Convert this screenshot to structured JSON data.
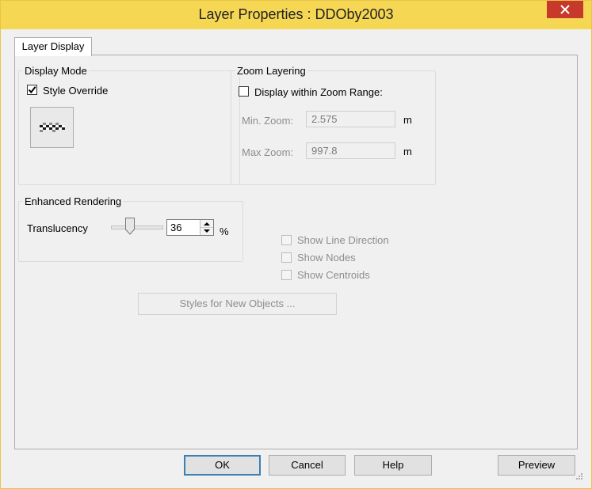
{
  "window": {
    "title": "Layer Properties  : DDOby2003"
  },
  "tabs": [
    {
      "label": "Layer Display"
    }
  ],
  "display_mode": {
    "title": "Display Mode",
    "style_override_label": "Style Override",
    "style_override_checked": true
  },
  "zoom_layering": {
    "title": "Zoom Layering",
    "display_within_label": "Display within Zoom Range:",
    "display_within_checked": false,
    "min_label": "Min. Zoom:",
    "min_value": "2.575",
    "min_unit": "m",
    "max_label": "Max Zoom:",
    "max_value": "997.8",
    "max_unit": "m"
  },
  "enhanced_rendering": {
    "title": "Enhanced Rendering",
    "translucency_label": "Translucency",
    "translucency_value": "36",
    "unit": "%"
  },
  "options": {
    "show_line_direction": "Show Line Direction",
    "show_nodes": "Show Nodes",
    "show_centroids": "Show Centroids"
  },
  "styles_button": "Styles for New Objects ...",
  "buttons": {
    "ok": "OK",
    "cancel": "Cancel",
    "help": "Help",
    "preview": "Preview"
  }
}
